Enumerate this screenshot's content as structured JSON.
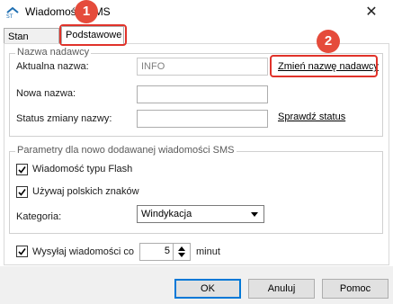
{
  "window": {
    "title": "Wiadomości SMS",
    "close_glyph": "✕"
  },
  "tabs": [
    {
      "label": "Stan usługi"
    },
    {
      "label": "Podstawowe"
    }
  ],
  "sender_group": {
    "title": "Nazwa nadawcy",
    "current_name_label": "Aktualna nazwa:",
    "current_name_value": "INFO",
    "change_link": "Zmień nazwę nadawcy",
    "new_name_label": "Nowa nazwa:",
    "new_name_value": "",
    "status_label": "Status zmiany nazwy:",
    "status_value": "",
    "check_status_link": "Sprawdź status"
  },
  "params_group": {
    "title": "Parametry dla nowo dodawanej wiadomości SMS",
    "flash_label": "Wiadomość typu Flash",
    "flash_checked": true,
    "polish_label": "Używaj polskich znaków",
    "polish_checked": true,
    "category_label": "Kategoria:",
    "category_value": "Windykacja"
  },
  "send_every": {
    "label": "Wysyłaj wiadomości co",
    "checked": true,
    "value": "5",
    "unit": "minut"
  },
  "buttons": {
    "ok": "OK",
    "cancel": "Anuluj",
    "help": "Pomoc"
  },
  "annotations": {
    "marker1": "1",
    "marker2": "2",
    "color": "#e0322a"
  }
}
